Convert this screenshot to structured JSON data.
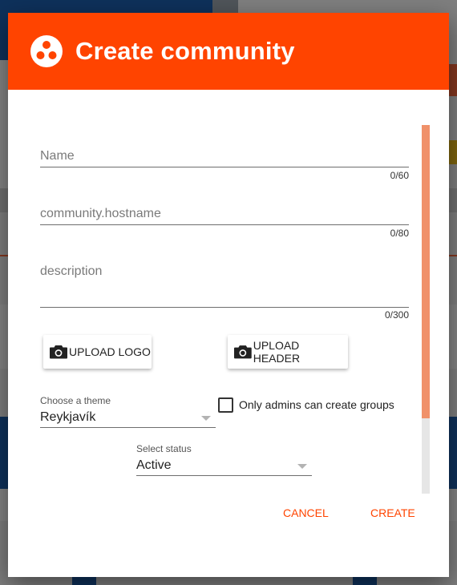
{
  "dialog": {
    "title": "Create community",
    "icon": "community-icon"
  },
  "form": {
    "name": {
      "placeholder": "Name",
      "value": "",
      "counter": "0/60"
    },
    "hostname": {
      "placeholder": "community.hostname",
      "value": "",
      "counter": "0/80"
    },
    "description": {
      "placeholder": "description",
      "value": "",
      "counter": "0/300"
    },
    "upload_logo_label": "UPLOAD LOGO",
    "upload_header_label": "UPLOAD HEADER",
    "theme": {
      "label": "Choose a theme",
      "value": "Reykjavík"
    },
    "only_admins": {
      "label": "Only admins can create groups",
      "checked": false
    },
    "status": {
      "label": "Select status",
      "value": "Active"
    }
  },
  "actions": {
    "cancel_label": "CANCEL",
    "create_label": "CREATE"
  },
  "colors": {
    "accent": "#ff4400",
    "scroll_thumb": "#f0916a"
  }
}
